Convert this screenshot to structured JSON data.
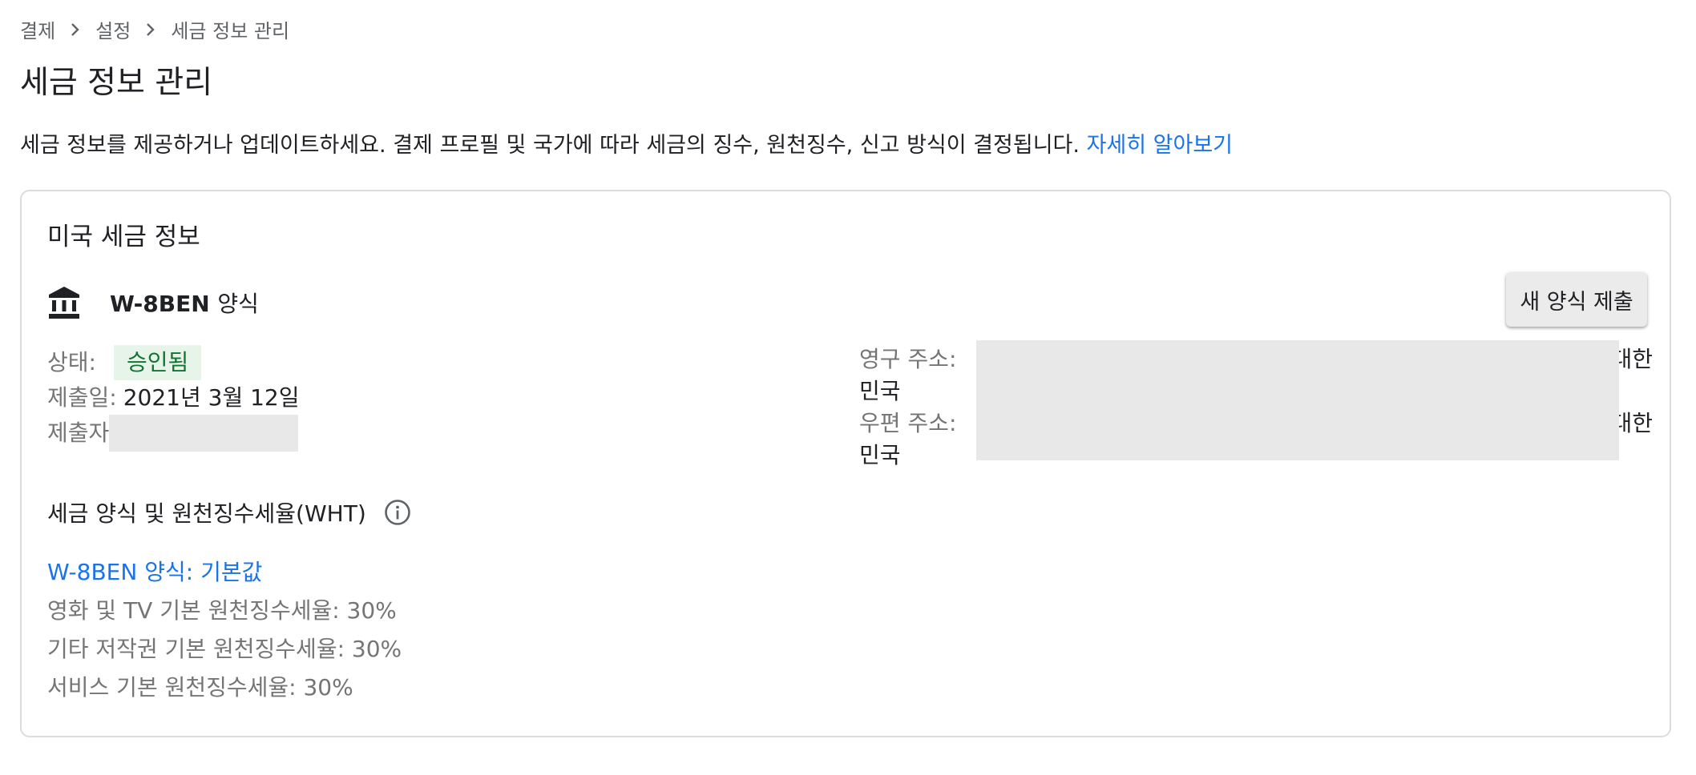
{
  "breadcrumb": {
    "items": [
      "결제",
      "설정",
      "세금 정보 관리"
    ]
  },
  "page": {
    "title": "세금 정보 관리",
    "intro": "세금 정보를 제공하거나 업데이트하세요. 결제 프로필 및 국가에 따라 세금의 징수, 원천징수, 신고 방식이 결정됩니다.",
    "learn_more": "자세히 알아보기"
  },
  "card": {
    "title": "미국 세금 정보",
    "form_name": "W-8BEN",
    "form_suffix": "양식",
    "submit_button": "새 양식 제출",
    "status_label": "상태:",
    "status_value": "승인됨",
    "submitted_label": "제출일:",
    "submitted_value": "2021년 3월 12일",
    "submitter_label": "제출자",
    "permanent_address_label": "영구 주소:",
    "permanent_address_country_a": "대한",
    "permanent_address_country_b": "민국",
    "mailing_address_label": "우편 주소:",
    "mailing_address_country_a": "대한",
    "mailing_address_country_b": "민국"
  },
  "wht": {
    "title": "세금 양식 및 원천징수세율(WHT)",
    "form_link": "W-8BEN 양식: 기본값",
    "rates": [
      "영화 및 TV 기본 원천징수세율: 30%",
      "기타 저작권 기본 원천징수세율: 30%",
      "서비스 기본 원천징수세율: 30%"
    ]
  },
  "icons": {
    "form": "bank-icon",
    "info": "info-icon",
    "separator": "chevron-right-icon"
  },
  "colors": {
    "link": "#1a73e8",
    "status_bg": "#e6f4ea",
    "status_text": "#137333",
    "redaction": "#e8e8e8"
  }
}
